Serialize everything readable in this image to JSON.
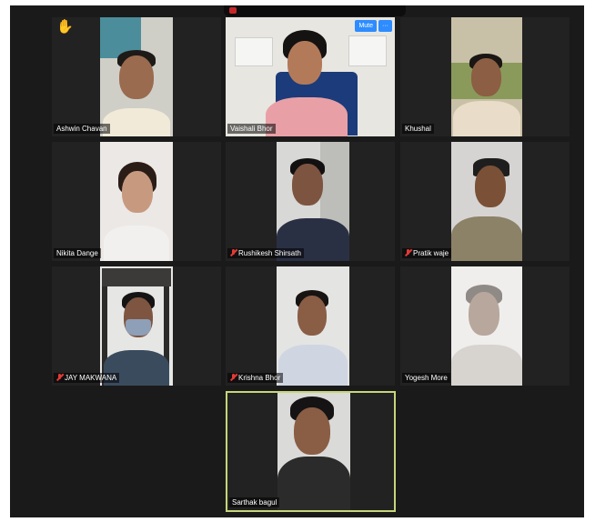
{
  "participants": [
    {
      "name": "Ashwin Chavan",
      "muted": false,
      "raised_hand": true
    },
    {
      "name": "Vaishali Bhor",
      "muted": false
    },
    {
      "name": "Khushal",
      "muted": false
    },
    {
      "name": "Nikita Dange",
      "muted": false
    },
    {
      "name": "Rushikesh Shirsath",
      "muted": true
    },
    {
      "name": "Pratik waje",
      "muted": true
    },
    {
      "name": "JAY MAKWANA",
      "muted": true
    },
    {
      "name": "Krishna Bhor",
      "muted": true
    },
    {
      "name": "Yogesh More",
      "muted": false
    },
    {
      "name": "Sarthak bagul",
      "muted": false,
      "active_speaker": true
    }
  ],
  "tile_menu": {
    "mute_label": "Mute",
    "more_label": "···"
  },
  "icons": {
    "raised_hand": "raised-hand-icon",
    "muted_mic": "mic-muted-icon"
  },
  "colors": {
    "active_speaker_border": "#c7d67a",
    "button_blue": "#2d8cff",
    "muted_red": "#e53935"
  }
}
